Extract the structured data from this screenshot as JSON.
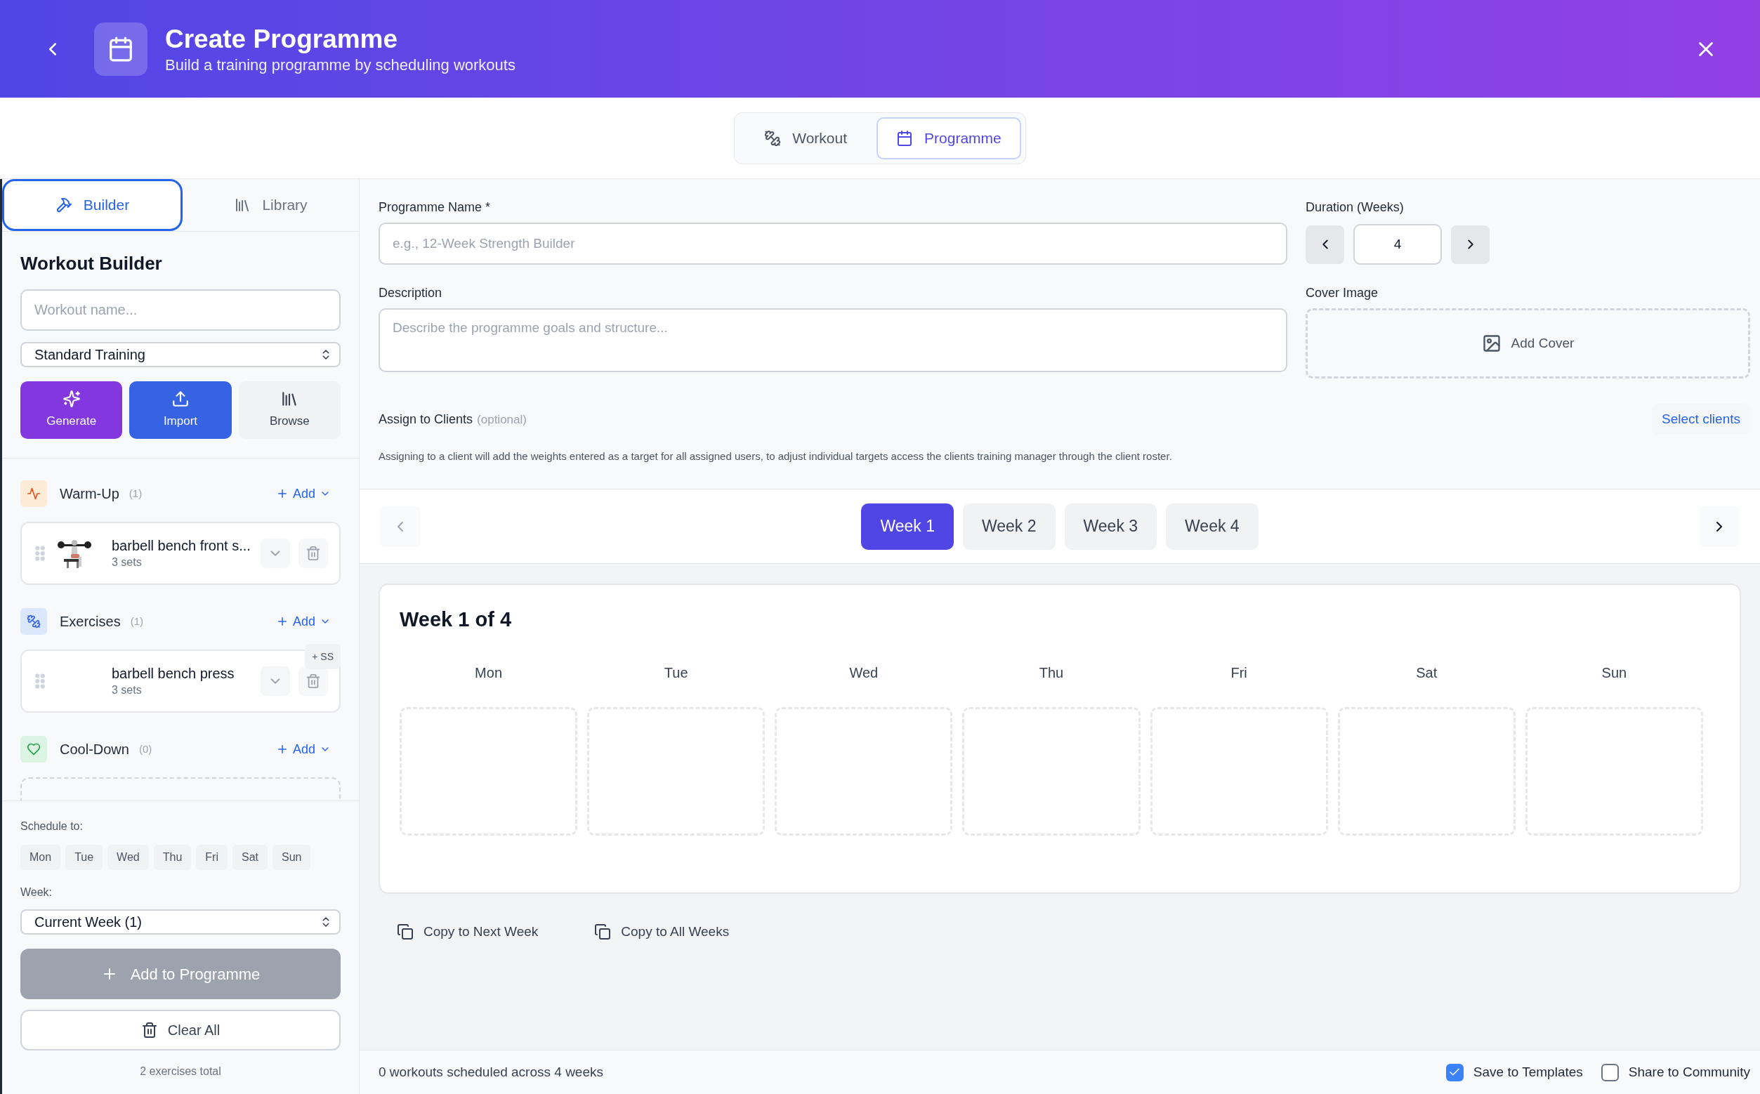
{
  "header": {
    "title": "Create Programme",
    "subtitle": "Build a training programme by scheduling workouts"
  },
  "mode_toggle": [
    {
      "label": "Workout",
      "kind": "workout",
      "selected": false
    },
    {
      "label": "Programme",
      "kind": "programme",
      "selected": true
    }
  ],
  "sidebar": {
    "tabs": [
      {
        "label": "Builder",
        "kind": "builder",
        "selected": true
      },
      {
        "label": "Library",
        "kind": "library",
        "selected": false
      }
    ],
    "heading": "Workout Builder",
    "workout_name": {
      "placeholder": "Workout name..."
    },
    "type_select": {
      "value": "Standard Training"
    },
    "actions": [
      {
        "label": "Generate",
        "kind": "generate"
      },
      {
        "label": "Import",
        "kind": "import"
      },
      {
        "label": "Browse",
        "kind": "browse"
      }
    ],
    "sections": [
      {
        "title": "Warm-Up",
        "count": "(1)",
        "kind": "warmup",
        "add_label": "Add",
        "exercises": [
          {
            "name": "barbell bench front s...",
            "sets": "3 sets",
            "image": true
          }
        ]
      },
      {
        "title": "Exercises",
        "count": "(1)",
        "kind": "main",
        "add_label": "Add",
        "exercises": [
          {
            "name": "barbell bench press",
            "sets": "3 sets",
            "image": false,
            "badge": "+ SS"
          }
        ]
      },
      {
        "title": "Cool-Down",
        "count": "(0)",
        "kind": "cooldown",
        "add_label": "Add"
      }
    ],
    "schedule_label": "Schedule to:",
    "days": [
      {
        "label": "Mon",
        "selected": false
      },
      {
        "label": "Tue",
        "selected": false
      },
      {
        "label": "Wed",
        "selected": false
      },
      {
        "label": "Thu",
        "selected": false
      },
      {
        "label": "Fri",
        "selected": false
      },
      {
        "label": "Sat",
        "selected": false
      },
      {
        "label": "Sun",
        "selected": false
      }
    ],
    "week_label": "Week:",
    "week_select": {
      "value": "Current Week (1)"
    },
    "add_button": {
      "label": "Add to Programme",
      "disabled": true
    },
    "clear_button": {
      "label": "Clear All"
    },
    "total": "2 exercises total"
  },
  "form": {
    "name_label": "Programme Name *",
    "name_field": {
      "placeholder": "e.g., 12-Week Strength Builder"
    },
    "duration_label": "Duration (Weeks)",
    "duration_value": "4",
    "description_label": "Description",
    "description_field": {
      "placeholder": "Describe the programme goals and structure..."
    },
    "cover_label": "Cover Image",
    "cover_button": "Add Cover",
    "assign_label": "Assign to Clients",
    "assign_hint": "(optional)",
    "select_clients": "Select clients",
    "assign_note": "Assigning to a client will add the weights entered as a target for all assigned users, to adjust individual targets access the clients training manager through the client roster."
  },
  "weeks": {
    "tabs": [
      {
        "label": "Week 1",
        "selected": true
      },
      {
        "label": "Week 2",
        "selected": false
      },
      {
        "label": "Week 3",
        "selected": false
      },
      {
        "label": "Week 4",
        "selected": false
      }
    ],
    "title": "Week 1 of 4",
    "days": [
      "Mon",
      "Tue",
      "Wed",
      "Thu",
      "Fri",
      "Sat",
      "Sun"
    ]
  },
  "copy_actions": [
    "Copy to Next Week",
    "Copy to All Weeks"
  ],
  "footer": {
    "summary": "0 workouts scheduled across 4 weeks",
    "options": [
      {
        "label": "Save to Templates",
        "checked": true
      },
      {
        "label": "Share to Community",
        "checked": false
      }
    ]
  }
}
